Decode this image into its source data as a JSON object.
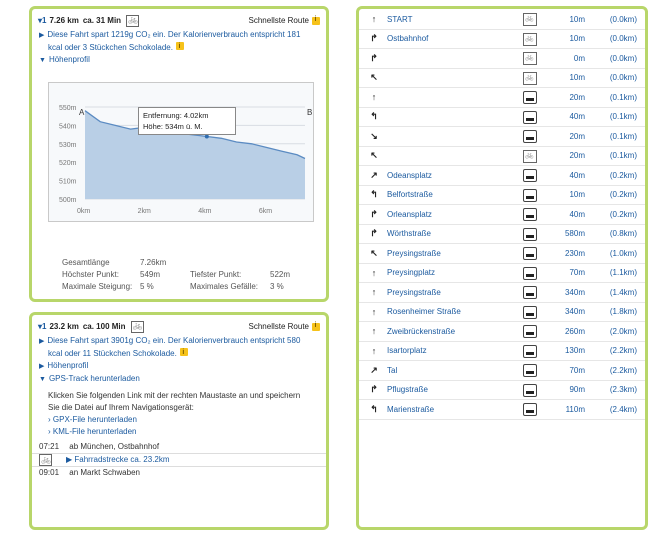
{
  "route1": {
    "num": "▾1",
    "km": "7.26 km",
    "time": "ca. 31 Min",
    "route_type": "Schnellste Route",
    "co2_text": "Diese Fahrt spart 1219g CO₂ ein. Der Kalorienverbrauch entspricht 181",
    "co2_text2": "kcal oder 3 Stückchen Schokolade.",
    "profile_label": "Höhenprofil",
    "tooltip_line1": "Entfernung: 4.02km",
    "tooltip_line2": "Höhe: 534m ü. M.",
    "marker_a": "A",
    "marker_b": "B",
    "stats": {
      "gesamt_label": "Gesamtlänge",
      "gesamt_value": "7.26km",
      "hoechst_label": "Höchster Punkt:",
      "hoechst_value": "549m",
      "tiefst_label": "Tiefster Punkt:",
      "tiefst_value": "522m",
      "steig_label": "Maximale Steigung:",
      "steig_value": "5 %",
      "gefaell_label": "Maximales Gefälle:",
      "gefaell_value": "3 %"
    }
  },
  "chart_data": {
    "type": "area",
    "title": "",
    "xlabel": "",
    "ylabel": "",
    "x_ticks": [
      "0km",
      "2km",
      "4km",
      "6km"
    ],
    "y_ticks": [
      "550m",
      "540m",
      "530m",
      "520m",
      "510m",
      "500m"
    ],
    "xlim": [
      0,
      7.26
    ],
    "ylim": [
      500,
      550
    ],
    "x": [
      0,
      0.5,
      1.0,
      1.5,
      2.0,
      2.5,
      3.0,
      3.5,
      4.0,
      4.5,
      5.0,
      5.5,
      6.0,
      6.5,
      7.0,
      7.26
    ],
    "y": [
      548,
      542,
      540,
      538,
      539,
      537,
      536,
      535,
      534,
      533,
      531,
      530,
      528,
      526,
      524,
      522
    ]
  },
  "route2": {
    "num": "▾1",
    "km": "23.2 km",
    "time": "ca. 100 Min",
    "route_type": "Schnellste Route",
    "co2_text": "Diese Fahrt spart 3901g CO₂ ein. Der Kalorienverbrauch entspricht 580",
    "co2_text2": "kcal oder 11 Stückchen Schokolade.",
    "profile_label": "Höhenprofil",
    "gps_label": "GPS-Track herunterladen",
    "gps_hint1": "Klicken Sie folgenden Link mit der rechten Maustaste an und speichern",
    "gps_hint2": "Sie die Datei auf Ihrem Navigationsgerät:",
    "gpx_link": "› GPX-File herunterladen",
    "kml_link": "› KML-File herunterladen",
    "dep_time": "07:21",
    "dep_text": "ab München, Ostbahnhof",
    "track_text": "▶ Fahrradstrecke ca. 23.2km",
    "arr_time": "09:01",
    "arr_text": "an Markt Schwaben"
  },
  "directions": [
    {
      "arrow": "↑",
      "name": "START",
      "icon": "bike",
      "dist": "10m",
      "cum": "(0.0km)"
    },
    {
      "arrow": "↱",
      "name": "Ostbahnhof",
      "icon": "bike",
      "dist": "10m",
      "cum": "(0.0km)"
    },
    {
      "arrow": "↱",
      "name": "",
      "icon": "bike",
      "dist": "0m",
      "cum": "(0.0km)"
    },
    {
      "arrow": "↖",
      "name": "",
      "icon": "bike",
      "dist": "10m",
      "cum": "(0.0km)"
    },
    {
      "arrow": "↑",
      "name": "",
      "icon": "road",
      "dist": "20m",
      "cum": "(0.1km)"
    },
    {
      "arrow": "↰",
      "name": "",
      "icon": "road",
      "dist": "40m",
      "cum": "(0.1km)"
    },
    {
      "arrow": "↘",
      "name": "",
      "icon": "road",
      "dist": "20m",
      "cum": "(0.1km)"
    },
    {
      "arrow": "↖",
      "name": "",
      "icon": "bike",
      "dist": "20m",
      "cum": "(0.1km)"
    },
    {
      "arrow": "↗",
      "name": "Odeansplatz",
      "icon": "road",
      "dist": "40m",
      "cum": "(0.2km)"
    },
    {
      "arrow": "↰",
      "name": "Belfortstraße",
      "icon": "road",
      "dist": "10m",
      "cum": "(0.2km)"
    },
    {
      "arrow": "↱",
      "name": "Orleansplatz",
      "icon": "road",
      "dist": "40m",
      "cum": "(0.2km)"
    },
    {
      "arrow": "↱",
      "name": "Wörthstraße",
      "icon": "road",
      "dist": "580m",
      "cum": "(0.8km)"
    },
    {
      "arrow": "↖",
      "name": "Preysingstraße",
      "icon": "road",
      "dist": "230m",
      "cum": "(1.0km)"
    },
    {
      "arrow": "↑",
      "name": "Preysingplatz",
      "icon": "road",
      "dist": "70m",
      "cum": "(1.1km)"
    },
    {
      "arrow": "↑",
      "name": "Preysingstraße",
      "icon": "road",
      "dist": "340m",
      "cum": "(1.4km)"
    },
    {
      "arrow": "↑",
      "name": "Rosenheimer Straße",
      "icon": "road",
      "dist": "340m",
      "cum": "(1.8km)"
    },
    {
      "arrow": "↑",
      "name": "Zweibrückenstraße",
      "icon": "road",
      "dist": "260m",
      "cum": "(2.0km)"
    },
    {
      "arrow": "↑",
      "name": "Isartorplatz",
      "icon": "road",
      "dist": "130m",
      "cum": "(2.2km)"
    },
    {
      "arrow": "↗",
      "name": "Tal",
      "icon": "road",
      "dist": "70m",
      "cum": "(2.2km)"
    },
    {
      "arrow": "↱",
      "name": "Pflugstraße",
      "icon": "road",
      "dist": "90m",
      "cum": "(2.3km)"
    },
    {
      "arrow": "↰",
      "name": "Marienstraße",
      "icon": "road",
      "dist": "110m",
      "cum": "(2.4km)"
    }
  ]
}
